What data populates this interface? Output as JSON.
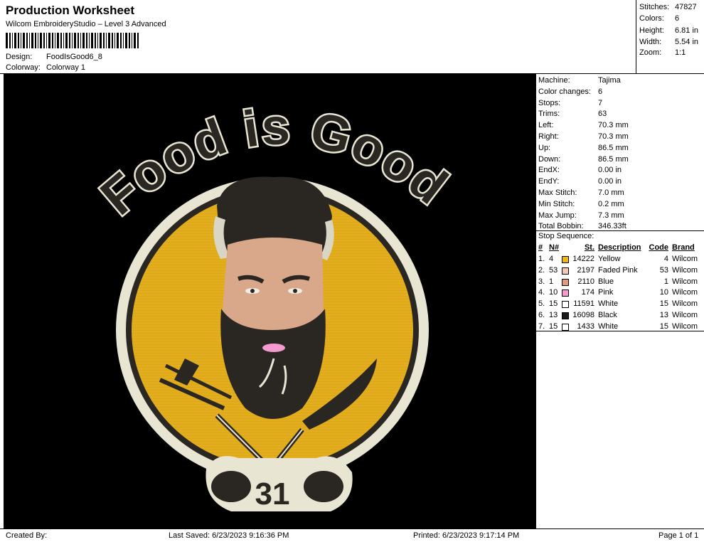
{
  "header": {
    "title": "Production Worksheet",
    "software": "Wilcom EmbroideryStudio – Level 3 Advanced",
    "design_label": "Design:",
    "design_value": "FoodIsGood6_8",
    "colorway_label": "Colorway:",
    "colorway_value": "Colorway 1"
  },
  "stats": [
    {
      "label": "Stitches:",
      "value": "47827"
    },
    {
      "label": "Colors:",
      "value": "6"
    },
    {
      "label": "Height:",
      "value": "6.81 in"
    },
    {
      "label": "Width:",
      "value": "5.54 in"
    },
    {
      "label": "Zoom:",
      "value": "1:1"
    }
  ],
  "machine_info": [
    {
      "label": "Machine:",
      "value": "Tajima"
    },
    {
      "label": "Color changes:",
      "value": "6"
    },
    {
      "label": "Stops:",
      "value": "7"
    },
    {
      "label": "Trims:",
      "value": "63"
    },
    {
      "label": "Left:",
      "value": "70.3 mm"
    },
    {
      "label": "Right:",
      "value": "70.3 mm"
    },
    {
      "label": "Up:",
      "value": "86.5 mm"
    },
    {
      "label": "Down:",
      "value": "86.5 mm"
    },
    {
      "label": "EndX:",
      "value": "0.00 in"
    },
    {
      "label": "EndY:",
      "value": "0.00 in"
    },
    {
      "label": "Max Stitch:",
      "value": "7.0 mm"
    },
    {
      "label": "Min Stitch:",
      "value": "0.2 mm"
    },
    {
      "label": "Max Jump:",
      "value": "7.3 mm"
    },
    {
      "label": "Total Bobbin:",
      "value": "346.33ft"
    }
  ],
  "stop_sequence": {
    "title": "Stop Sequence:",
    "headers": {
      "num": "#",
      "n": "N#",
      "st": "St.",
      "desc": "Description",
      "code": "Code",
      "brand": "Brand"
    },
    "rows": [
      {
        "num": "1.",
        "n": "4",
        "color": "#F2B705",
        "st": "14222",
        "desc": "Yellow",
        "code": "4",
        "brand": "Wilcom"
      },
      {
        "num": "2.",
        "n": "53",
        "color": "#F4C7B4",
        "st": "2197",
        "desc": "Faded Pink",
        "code": "53",
        "brand": "Wilcom"
      },
      {
        "num": "3.",
        "n": "1",
        "color": "#E29A7A",
        "st": "2110",
        "desc": "Blue",
        "code": "1",
        "brand": "Wilcom"
      },
      {
        "num": "4.",
        "n": "10",
        "color": "#F49AD0",
        "st": "174",
        "desc": "Pink",
        "code": "10",
        "brand": "Wilcom"
      },
      {
        "num": "5.",
        "n": "15",
        "color": "#FFFFFF",
        "st": "11591",
        "desc": "White",
        "code": "15",
        "brand": "Wilcom"
      },
      {
        "num": "6.",
        "n": "13",
        "color": "#1A1A1A",
        "st": "16098",
        "desc": "Black",
        "code": "13",
        "brand": "Wilcom"
      },
      {
        "num": "7.",
        "n": "15",
        "color": "#FFFFFF",
        "st": "1433",
        "desc": "White",
        "code": "15",
        "brand": "Wilcom"
      }
    ]
  },
  "design": {
    "arch_text": "Food is Good",
    "badge_number": "31",
    "colors": {
      "yellow": "#E3AE1E",
      "cream": "#E8E6D3",
      "dark": "#2A2723",
      "skin": "#D9A78A",
      "bg": "#000000"
    }
  },
  "footer": {
    "created_by": "Created By:",
    "last_saved": "Last Saved: 6/23/2023 9:16:36 PM",
    "printed": "Printed: 6/23/2023 9:17:14 PM",
    "page": "Page 1 of 1"
  }
}
